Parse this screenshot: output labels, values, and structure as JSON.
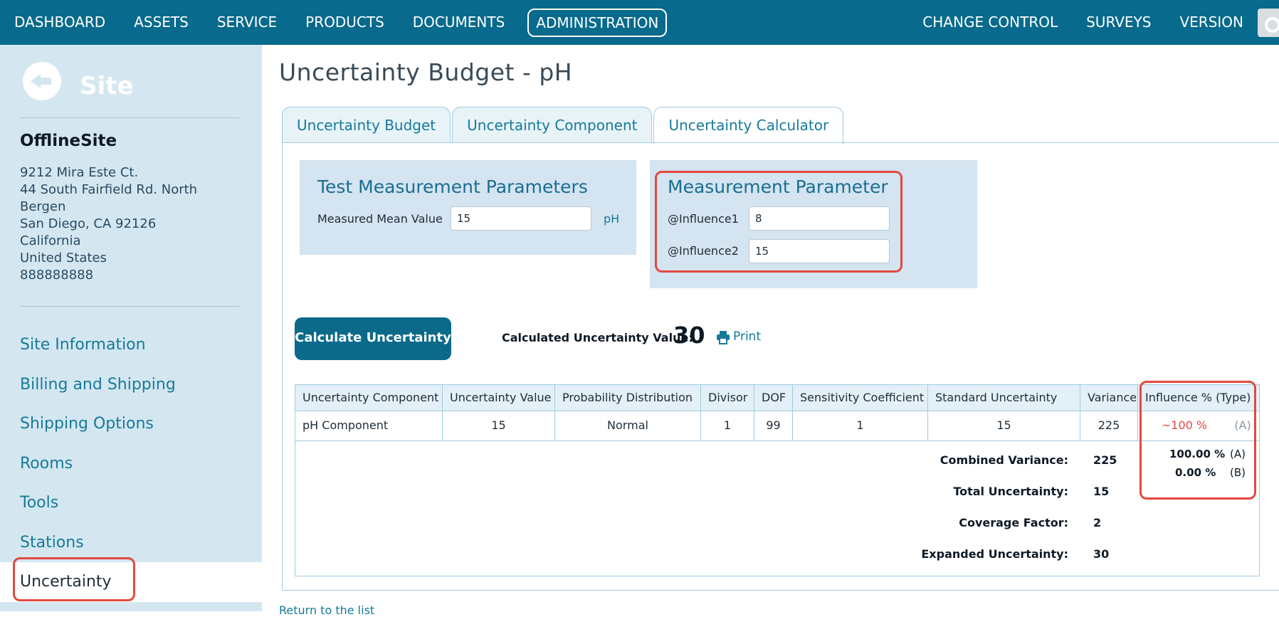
{
  "topnav": {
    "left": [
      "DASHBOARD",
      "ASSETS",
      "SERVICE",
      "PRODUCTS",
      "DOCUMENTS",
      "ADMINISTRATION"
    ],
    "right": [
      "CHANGE CONTROL",
      "SURVEYS",
      "VERSION"
    ],
    "active": "ADMINISTRATION"
  },
  "sidebar": {
    "heading": "Site",
    "site_name": "OfflineSite",
    "address": [
      "9212 Mira Este Ct.",
      "44 South Fairfield Rd. North",
      "Bergen",
      "San Diego, CA 92126",
      "California",
      "United States",
      "888888888"
    ],
    "nav": [
      "Site Information",
      "Billing and Shipping",
      "Shipping Options",
      "Rooms",
      "Tools",
      "Stations",
      "Uncertainty"
    ],
    "active_nav": "Uncertainty"
  },
  "page": {
    "title": "Uncertainty Budget - pH",
    "tabs": [
      "Uncertainty Budget",
      "Uncertainty Component",
      "Uncertainty Calculator"
    ],
    "active_tab": "Uncertainty Calculator"
  },
  "test_params": {
    "title": "Test Measurement Parameters",
    "measured_mean_label": "Measured Mean Value",
    "measured_mean_value": "15",
    "unit": "pH"
  },
  "measurement_param": {
    "title": "Measurement Parameter",
    "influence1_label": "@Influence1",
    "influence1_value": "8",
    "influence2_label": "@Influence2",
    "influence2_value": "15"
  },
  "calc": {
    "button": "Calculate Uncertainty",
    "label": "Calculated Uncertainty Value:",
    "value": "30",
    "print": "Print"
  },
  "table": {
    "headers": [
      "Uncertainty Component",
      "Uncertainty Value",
      "Probability Distribution",
      "Divisor",
      "DOF",
      "Sensitivity Coefficient",
      "Standard Uncertainty",
      "Variance",
      "Influence % (Type)"
    ],
    "row": {
      "component": "pH Component",
      "value": "15",
      "distribution": "Normal",
      "divisor": "1",
      "dof": "99",
      "sensitivity": "1",
      "standard": "15",
      "variance": "225",
      "influence": "~100 %",
      "type": "(A)"
    },
    "summary": {
      "combined_variance_label": "Combined Variance:",
      "combined_variance": "225",
      "total_uncertainty_label": "Total Uncertainty:",
      "total_uncertainty": "15",
      "coverage_factor_label": "Coverage Factor:",
      "coverage_factor": "2",
      "expanded_uncertainty_label": "Expanded Uncertainty:",
      "expanded_uncertainty": "30",
      "influence_a": "100.00 %",
      "type_a": "(A)",
      "influence_b": "0.00 %",
      "type_b": "(B)"
    }
  },
  "return_link": "Return to the list",
  "colors": {
    "nav": "#086a8c",
    "sidebar": "#d4e7f1",
    "highlight": "#e2493f",
    "accent": "#167a99"
  }
}
